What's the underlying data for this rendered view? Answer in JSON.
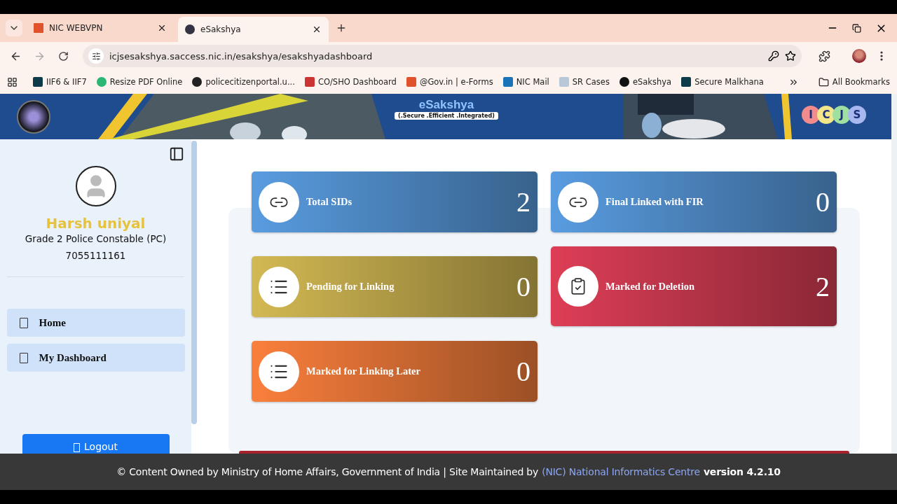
{
  "browser": {
    "tabs": [
      {
        "title": "NIC WEBVPN",
        "selected": false
      },
      {
        "title": "eSakshya",
        "selected": true
      }
    ],
    "address": "icjsesakshya.saccess.nic.in/esakshya/esakshyadashboard",
    "bookmarks": [
      "IIF6 & IIF7",
      "Resize PDF Online",
      "policecitizenportal.u...",
      "CO/SHO Dashboard",
      "@Gov.in | e-Forms",
      "NIC Mail",
      "SR Cases",
      "eSakshya",
      "Secure Malkhana"
    ],
    "all_bookmarks": "All Bookmarks"
  },
  "header": {
    "app_name": "eSakshya",
    "tagline": "(.Secure .Efficient .Integrated)",
    "partner_letters": [
      "I",
      "C",
      "J",
      "S"
    ]
  },
  "sidebar": {
    "name": "Harsh uniyal",
    "designation": "Grade 2 Police Constable (PC)",
    "phone": "7055111161",
    "nav": [
      {
        "label": "Home"
      },
      {
        "label": "My Dashboard"
      }
    ],
    "logout": "Logout"
  },
  "cards": [
    {
      "label": "Total SIDs",
      "count": "2",
      "color": "#4a82bb",
      "kind": "link"
    },
    {
      "label": "Final Linked with FIR",
      "count": "0",
      "color": "#4a82bb",
      "kind": "link"
    },
    {
      "label": "Pending for Linking",
      "count": "0",
      "color": "#b09a45",
      "kind": "list"
    },
    {
      "label": "Marked for Deletion",
      "count": "2",
      "color": "#b83448",
      "kind": "clipboard"
    },
    {
      "label": "Marked for Linking Later",
      "count": "0",
      "color": "#d06a32",
      "kind": "list"
    }
  ],
  "footer": {
    "text": "© Content Owned by Ministry of Home Affairs, Government of India | Site Maintained by",
    "link": "(NIC) National Informatics Centre",
    "version": "version 4.2.10"
  }
}
